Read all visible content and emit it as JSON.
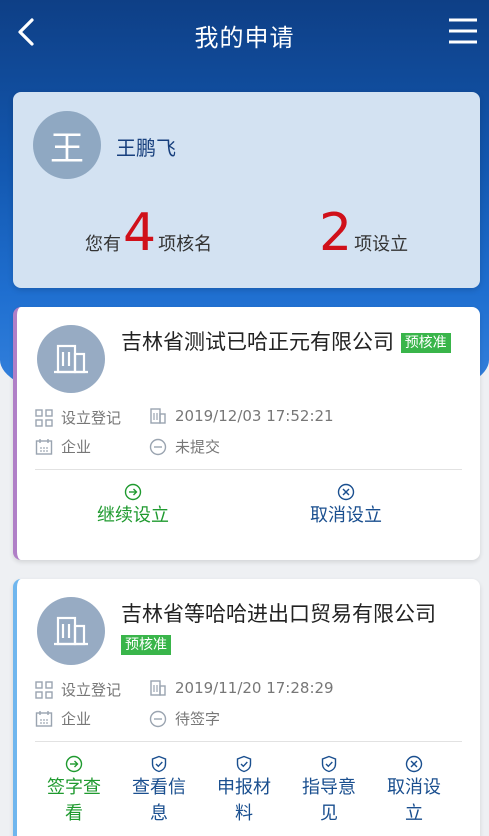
{
  "header": {
    "title": "我的申请"
  },
  "user": {
    "avatar_initial": "王",
    "name": "王鹏飞"
  },
  "summary": {
    "left_prefix": "您有",
    "left_count": "4",
    "left_suffix": "项核名",
    "right_count": "2",
    "right_suffix": "项设立"
  },
  "applications": [
    {
      "company_name": "吉林省测试已哈正元有限公司",
      "badge": "预核准",
      "type": "设立登记",
      "datetime": "2019/12/03 17:52:21",
      "category": "企业",
      "status": "未提交",
      "actions": [
        {
          "label": "继续设立",
          "icon": "arrow-right-circle-icon",
          "color": "#1f9a2f"
        },
        {
          "label": "取消设立",
          "icon": "close-circle-icon",
          "color": "#1a4f8f"
        }
      ]
    },
    {
      "company_name": "吉林省等哈哈进出口贸易有限公司",
      "badge": "预核准",
      "type": "设立登记",
      "datetime": "2019/11/20 17:28:29",
      "category": "企业",
      "status": "待签字",
      "actions": [
        {
          "label": "签字查看",
          "icon": "arrow-right-circle-icon",
          "color": "#1f9a2f"
        },
        {
          "label": "查看信息",
          "icon": "shield-check-icon",
          "color": "#1a4f8f"
        },
        {
          "label": "申报材料",
          "icon": "shield-check-icon",
          "color": "#1a4f8f"
        },
        {
          "label": "指导意见",
          "icon": "shield-check-icon",
          "color": "#1a4f8f"
        },
        {
          "label": "取消设立",
          "icon": "close-circle-icon",
          "color": "#1a4f8f"
        }
      ]
    }
  ]
}
